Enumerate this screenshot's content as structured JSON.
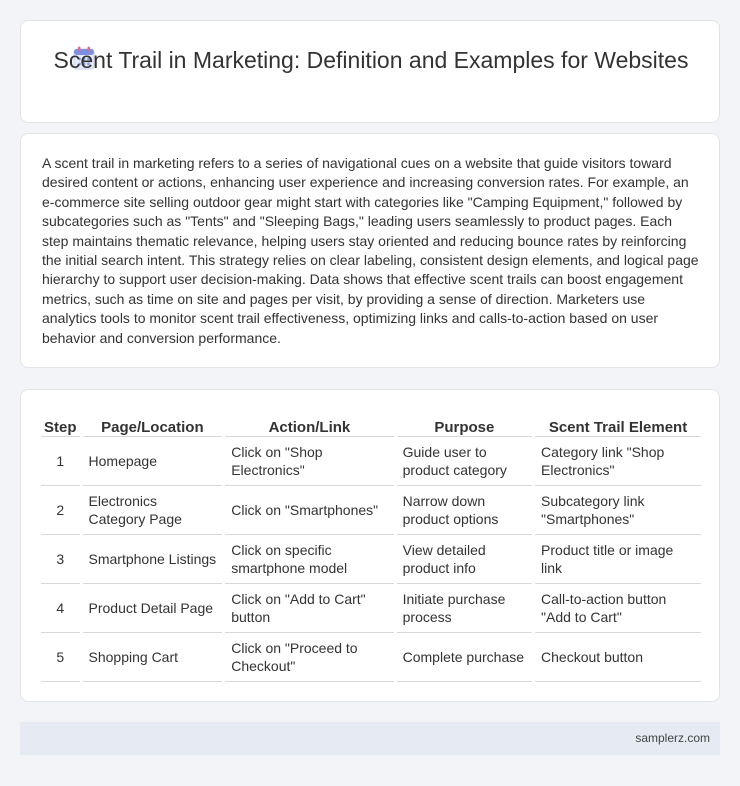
{
  "header": {
    "title": "Scent Trail in Marketing: Definition and Examples for Websites",
    "icon": "calendar-icon"
  },
  "intro": {
    "text": "A scent trail in marketing refers to a series of navigational cues on a website that guide visitors toward desired content or actions, enhancing user experience and increasing conversion rates. For example, an e-commerce site selling outdoor gear might start with categories like \"Camping Equipment,\" followed by subcategories such as \"Tents\" and \"Sleeping Bags,\" leading users seamlessly to product pages. Each step maintains thematic relevance, helping users stay oriented and reducing bounce rates by reinforcing the initial search intent. This strategy relies on clear labeling, consistent design elements, and logical page hierarchy to support user decision-making. Data shows that effective scent trails can boost engagement metrics, such as time on site and pages per visit, by providing a sense of direction. Marketers use analytics tools to monitor scent trail effectiveness, optimizing links and calls-to-action based on user behavior and conversion performance."
  },
  "table": {
    "headers": [
      "Step",
      "Page/Location",
      "Action/Link",
      "Purpose",
      "Scent Trail Element"
    ],
    "rows": [
      [
        "1",
        "Homepage",
        "Click on \"Shop Electronics\"",
        "Guide user to product category",
        "Category link \"Shop Electronics\""
      ],
      [
        "2",
        "Electronics Category Page",
        "Click on \"Smartphones\"",
        "Narrow down product options",
        "Subcategory link \"Smartphones\""
      ],
      [
        "3",
        "Smartphone Listings",
        "Click on specific smartphone model",
        "View detailed product info",
        "Product title or image link"
      ],
      [
        "4",
        "Product Detail Page",
        "Click on \"Add to Cart\" button",
        "Initiate purchase process",
        "Call-to-action button \"Add to Cart\""
      ],
      [
        "5",
        "Shopping Cart",
        "Click on \"Proceed to Checkout\"",
        "Complete purchase",
        "Checkout button"
      ]
    ]
  },
  "footer": {
    "site": "samplerz.com"
  }
}
